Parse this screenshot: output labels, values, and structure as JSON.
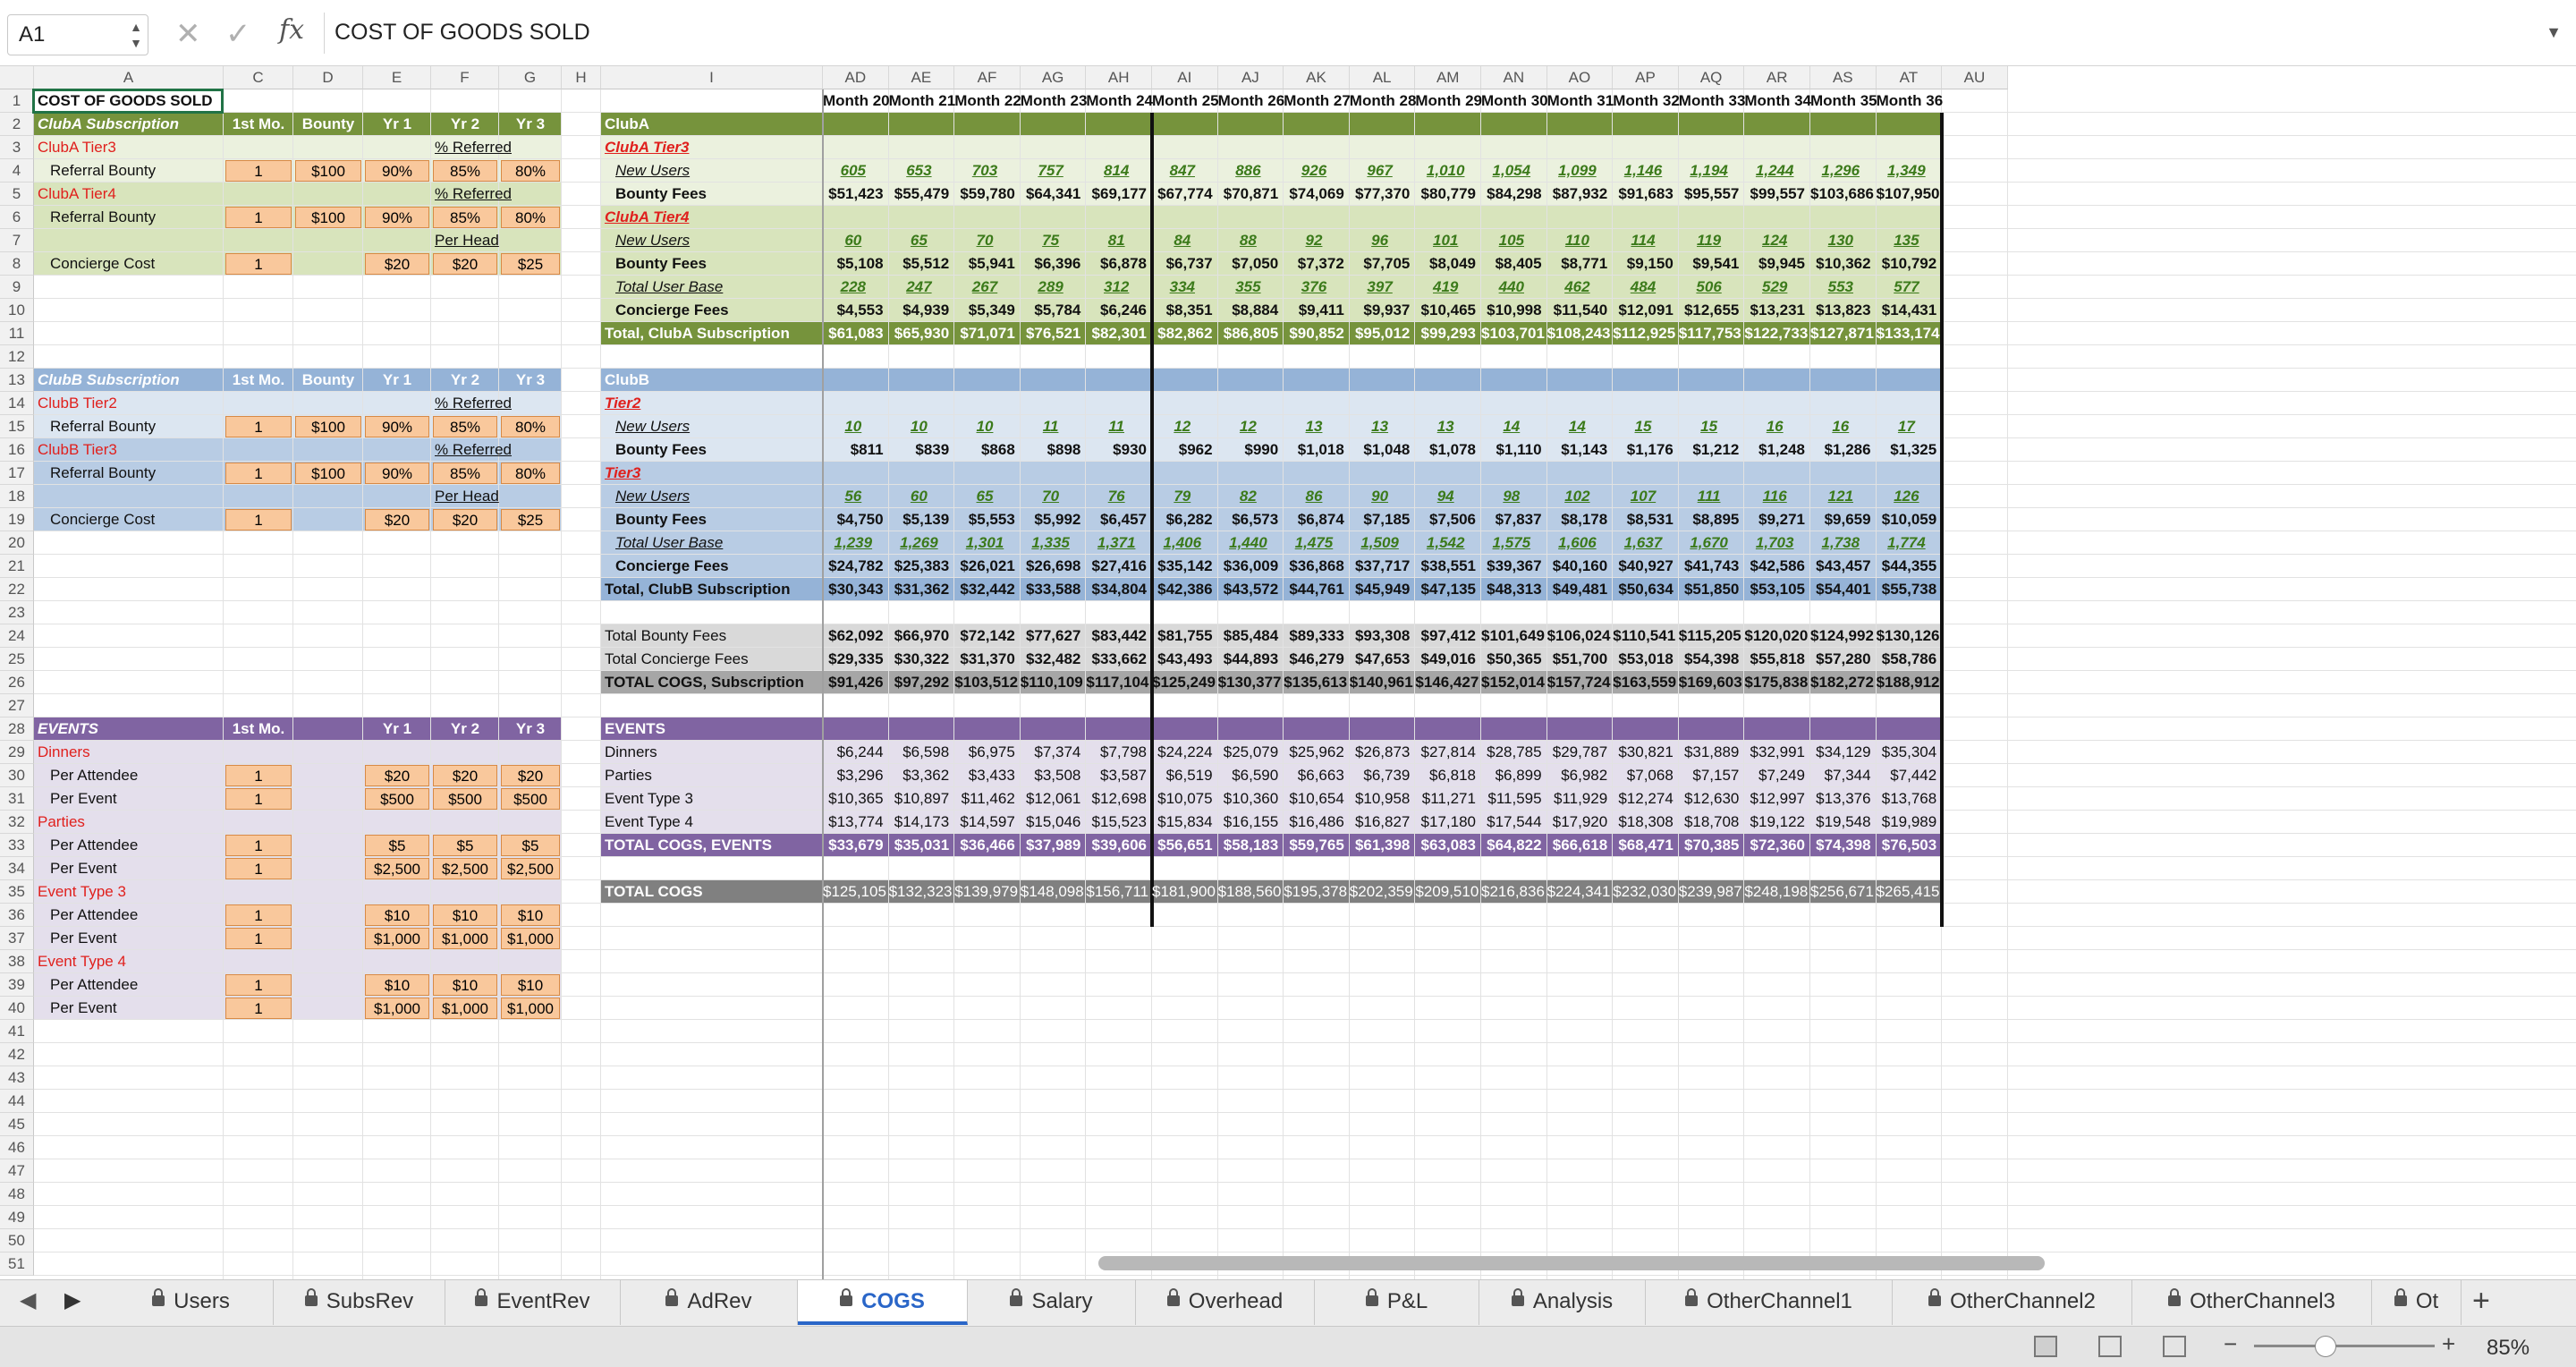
{
  "namebox": "A1",
  "formula": "COST OF GOODS SOLD",
  "zoom": "85%",
  "columns_left": [
    [
      "A",
      38,
      212
    ],
    [
      "C",
      250,
      78
    ],
    [
      "D",
      328,
      78
    ],
    [
      "E",
      406,
      76
    ],
    [
      "F",
      482,
      76
    ],
    [
      "G",
      558,
      70
    ],
    [
      "H",
      628,
      44
    ],
    [
      "I",
      672,
      248
    ]
  ],
  "columns_right": [
    "AD",
    "AE",
    "AF",
    "AG",
    "AH",
    "AI",
    "AJ",
    "AK",
    "AL",
    "AM",
    "AN",
    "AO",
    "AP",
    "AQ",
    "AR",
    "AS",
    "AT",
    "AU"
  ],
  "months": [
    "Month 20",
    "Month 21",
    "Month 22",
    "Month 23",
    "Month 24",
    "Month 25",
    "Month 26",
    "Month 27",
    "Month 28",
    "Month 29",
    "Month 30",
    "Month 31",
    "Month 32",
    "Month 33",
    "Month 34",
    "Month 35",
    "Month 36"
  ],
  "left": {
    "r1": "COST OF GOODS SOLD",
    "clubA": {
      "title": "ClubA Subscription",
      "h": [
        "1st Mo.",
        "Bounty",
        "Yr 1",
        "Yr 2",
        "Yr 3"
      ],
      "t3": "ClubA Tier3",
      "pct1": "% Referred",
      "rb": "Referral Bounty",
      "v1": [
        "1",
        "$100",
        "90%",
        "85%",
        "80%"
      ],
      "t4": "ClubA Tier4",
      "pct2": "% Referred",
      "v2": [
        "1",
        "$100",
        "90%",
        "85%",
        "80%"
      ],
      "perhead": "Per Head",
      "cc": "Concierge Cost",
      "v3": [
        "1",
        "$20",
        "$20",
        "$25"
      ]
    },
    "clubB": {
      "title": "ClubB Subscription",
      "h": [
        "1st Mo.",
        "Bounty",
        "Yr 1",
        "Yr 2",
        "Yr 3"
      ],
      "t2": "ClubB Tier2",
      "pct1": "% Referred",
      "rb": "Referral Bounty",
      "v1": [
        "1",
        "$100",
        "90%",
        "85%",
        "80%"
      ],
      "t3": "ClubB Tier3",
      "pct2": "% Referred",
      "v2": [
        "1",
        "$100",
        "90%",
        "85%",
        "80%"
      ],
      "perhead": "Per Head",
      "cc": "Concierge Cost",
      "v3": [
        "1",
        "$20",
        "$20",
        "$25"
      ]
    },
    "events": {
      "title": "EVENTS",
      "h": [
        "1st Mo.",
        "Yr 1",
        "Yr 2",
        "Yr 3"
      ],
      "groups": [
        {
          "name": "Dinners",
          "pa": [
            "1",
            "$20",
            "$20",
            "$20"
          ],
          "pe": [
            "1",
            "$500",
            "$500",
            "$500"
          ]
        },
        {
          "name": "Parties",
          "pa": [
            "1",
            "$5",
            "$5",
            "$5"
          ],
          "pe": [
            "1",
            "$2,500",
            "$2,500",
            "$2,500"
          ]
        },
        {
          "name": "Event Type 3",
          "pa": [
            "1",
            "$10",
            "$10",
            "$10"
          ],
          "pe": [
            "1",
            "$1,000",
            "$1,000",
            "$1,000"
          ]
        },
        {
          "name": "Event Type 4",
          "pa": [
            "1",
            "$10",
            "$10",
            "$10"
          ],
          "pe": [
            "1",
            "$1,000",
            "$1,000",
            "$1,000"
          ]
        }
      ],
      "pa_label": "Per Attendee",
      "pe_label": "Per Event"
    }
  },
  "labels_I": {
    "3": "ClubA",
    "4": "ClubA Tier3",
    "5": "New Users",
    "6": "Bounty Fees",
    "7": "ClubA Tier4",
    "8": "New Users",
    "9": "Bounty Fees",
    "10": "Total User Base",
    "11": "Concierge Fees",
    "12": "Total, ClubA Subscription",
    "14": "ClubB",
    "15": "Tier2",
    "16": "New Users",
    "17": "Bounty Fees",
    "18": "Tier3",
    "19": "New Users",
    "20": "Bounty Fees",
    "21": "Total User Base",
    "22": "Concierge Fees",
    "23": "Total, ClubB Subscription",
    "25": "Total Bounty Fees",
    "26": "Total Concierge Fees",
    "27": "TOTAL COGS, Subscription",
    "29": "EVENTS",
    "30": "Dinners",
    "31": "Parties",
    "32": "Event Type 3",
    "33": "Event Type 4",
    "34": "TOTAL COGS, EVENTS",
    "36": "TOTAL COGS"
  },
  "rows": {
    "5": [
      "605",
      "653",
      "703",
      "757",
      "814",
      "847",
      "886",
      "926",
      "967",
      "1,010",
      "1,054",
      "1,099",
      "1,146",
      "1,194",
      "1,244",
      "1,296",
      "1,349"
    ],
    "6": [
      "$51,423",
      "$55,479",
      "$59,780",
      "$64,341",
      "$69,177",
      "$67,774",
      "$70,871",
      "$74,069",
      "$77,370",
      "$80,779",
      "$84,298",
      "$87,932",
      "$91,683",
      "$95,557",
      "$99,557",
      "$103,686",
      "$107,950"
    ],
    "8": [
      "60",
      "65",
      "70",
      "75",
      "81",
      "84",
      "88",
      "92",
      "96",
      "101",
      "105",
      "110",
      "114",
      "119",
      "124",
      "130",
      "135"
    ],
    "9": [
      "$5,108",
      "$5,512",
      "$5,941",
      "$6,396",
      "$6,878",
      "$6,737",
      "$7,050",
      "$7,372",
      "$7,705",
      "$8,049",
      "$8,405",
      "$8,771",
      "$9,150",
      "$9,541",
      "$9,945",
      "$10,362",
      "$10,792"
    ],
    "10": [
      "228",
      "247",
      "267",
      "289",
      "312",
      "334",
      "355",
      "376",
      "397",
      "419",
      "440",
      "462",
      "484",
      "506",
      "529",
      "553",
      "577"
    ],
    "11": [
      "$4,553",
      "$4,939",
      "$5,349",
      "$5,784",
      "$6,246",
      "$8,351",
      "$8,884",
      "$9,411",
      "$9,937",
      "$10,465",
      "$10,998",
      "$11,540",
      "$12,091",
      "$12,655",
      "$13,231",
      "$13,823",
      "$14,431"
    ],
    "12": [
      "$61,083",
      "$65,930",
      "$71,071",
      "$76,521",
      "$82,301",
      "$82,862",
      "$86,805",
      "$90,852",
      "$95,012",
      "$99,293",
      "$103,701",
      "$108,243",
      "$112,925",
      "$117,753",
      "$122,733",
      "$127,871",
      "$133,174"
    ],
    "16": [
      "10",
      "10",
      "10",
      "11",
      "11",
      "12",
      "12",
      "13",
      "13",
      "13",
      "14",
      "14",
      "15",
      "15",
      "16",
      "16",
      "17"
    ],
    "17": [
      "$811",
      "$839",
      "$868",
      "$898",
      "$930",
      "$962",
      "$990",
      "$1,018",
      "$1,048",
      "$1,078",
      "$1,110",
      "$1,143",
      "$1,176",
      "$1,212",
      "$1,248",
      "$1,286",
      "$1,325"
    ],
    "19": [
      "56",
      "60",
      "65",
      "70",
      "76",
      "79",
      "82",
      "86",
      "90",
      "94",
      "98",
      "102",
      "107",
      "111",
      "116",
      "121",
      "126"
    ],
    "20": [
      "$4,750",
      "$5,139",
      "$5,553",
      "$5,992",
      "$6,457",
      "$6,282",
      "$6,573",
      "$6,874",
      "$7,185",
      "$7,506",
      "$7,837",
      "$8,178",
      "$8,531",
      "$8,895",
      "$9,271",
      "$9,659",
      "$10,059"
    ],
    "21": [
      "1,239",
      "1,269",
      "1,301",
      "1,335",
      "1,371",
      "1,406",
      "1,440",
      "1,475",
      "1,509",
      "1,542",
      "1,575",
      "1,606",
      "1,637",
      "1,670",
      "1,703",
      "1,738",
      "1,774"
    ],
    "22": [
      "$24,782",
      "$25,383",
      "$26,021",
      "$26,698",
      "$27,416",
      "$35,142",
      "$36,009",
      "$36,868",
      "$37,717",
      "$38,551",
      "$39,367",
      "$40,160",
      "$40,927",
      "$41,743",
      "$42,586",
      "$43,457",
      "$44,355"
    ],
    "23": [
      "$30,343",
      "$31,362",
      "$32,442",
      "$33,588",
      "$34,804",
      "$42,386",
      "$43,572",
      "$44,761",
      "$45,949",
      "$47,135",
      "$48,313",
      "$49,481",
      "$50,634",
      "$51,850",
      "$53,105",
      "$54,401",
      "$55,738"
    ],
    "25": [
      "$62,092",
      "$66,970",
      "$72,142",
      "$77,627",
      "$83,442",
      "$81,755",
      "$85,484",
      "$89,333",
      "$93,308",
      "$97,412",
      "$101,649",
      "$106,024",
      "$110,541",
      "$115,205",
      "$120,020",
      "$124,992",
      "$130,126"
    ],
    "26": [
      "$29,335",
      "$30,322",
      "$31,370",
      "$32,482",
      "$33,662",
      "$43,493",
      "$44,893",
      "$46,279",
      "$47,653",
      "$49,016",
      "$50,365",
      "$51,700",
      "$53,018",
      "$54,398",
      "$55,818",
      "$57,280",
      "$58,786"
    ],
    "27": [
      "$91,426",
      "$97,292",
      "$103,512",
      "$110,109",
      "$117,104",
      "$125,249",
      "$130,377",
      "$135,613",
      "$140,961",
      "$146,427",
      "$152,014",
      "$157,724",
      "$163,559",
      "$169,603",
      "$175,838",
      "$182,272",
      "$188,912"
    ],
    "30": [
      "$6,244",
      "$6,598",
      "$6,975",
      "$7,374",
      "$7,798",
      "$24,224",
      "$25,079",
      "$25,962",
      "$26,873",
      "$27,814",
      "$28,785",
      "$29,787",
      "$30,821",
      "$31,889",
      "$32,991",
      "$34,129",
      "$35,304"
    ],
    "31": [
      "$3,296",
      "$3,362",
      "$3,433",
      "$3,508",
      "$3,587",
      "$6,519",
      "$6,590",
      "$6,663",
      "$6,739",
      "$6,818",
      "$6,899",
      "$6,982",
      "$7,068",
      "$7,157",
      "$7,249",
      "$7,344",
      "$7,442"
    ],
    "32": [
      "$10,365",
      "$10,897",
      "$11,462",
      "$12,061",
      "$12,698",
      "$10,075",
      "$10,360",
      "$10,654",
      "$10,958",
      "$11,271",
      "$11,595",
      "$11,929",
      "$12,274",
      "$12,630",
      "$12,997",
      "$13,376",
      "$13,768"
    ],
    "33": [
      "$13,774",
      "$14,173",
      "$14,597",
      "$15,046",
      "$15,523",
      "$15,834",
      "$16,155",
      "$16,486",
      "$16,827",
      "$17,180",
      "$17,544",
      "$17,920",
      "$18,308",
      "$18,708",
      "$19,122",
      "$19,548",
      "$19,989"
    ],
    "34": [
      "$33,679",
      "$35,031",
      "$36,466",
      "$37,989",
      "$39,606",
      "$56,651",
      "$58,183",
      "$59,765",
      "$61,398",
      "$63,083",
      "$64,822",
      "$66,618",
      "$68,471",
      "$70,385",
      "$72,360",
      "$74,398",
      "$76,503"
    ],
    "36": [
      "$125,105",
      "$132,323",
      "$139,979",
      "$148,098",
      "$156,711",
      "$181,900",
      "$188,560",
      "$195,378",
      "$202,359",
      "$209,510",
      "$216,836",
      "$224,341",
      "$232,030",
      "$239,987",
      "$248,198",
      "$256,671",
      "$265,415"
    ]
  },
  "tabs": [
    "Users",
    "SubsRev",
    "EventRev",
    "AdRev",
    "COGS",
    "Salary",
    "Overhead",
    "P&L",
    "Analysis",
    "OtherChannel1",
    "OtherChannel2",
    "OtherChannel3",
    "Ot"
  ],
  "active_tab": "COGS",
  "colors": {
    "green": "#76933c",
    "lightgreen": "#ebf1de",
    "midgreen": "#d8e4bc",
    "blue": "#95b3d7",
    "lightblue": "#dce6f1",
    "midblue": "#b8cce4",
    "purple": "#8064a2",
    "lightpurple": "#e4dfec",
    "gray": "#a6a6a6",
    "lightgray": "#d9d9d9",
    "darkgray": "#808080"
  }
}
